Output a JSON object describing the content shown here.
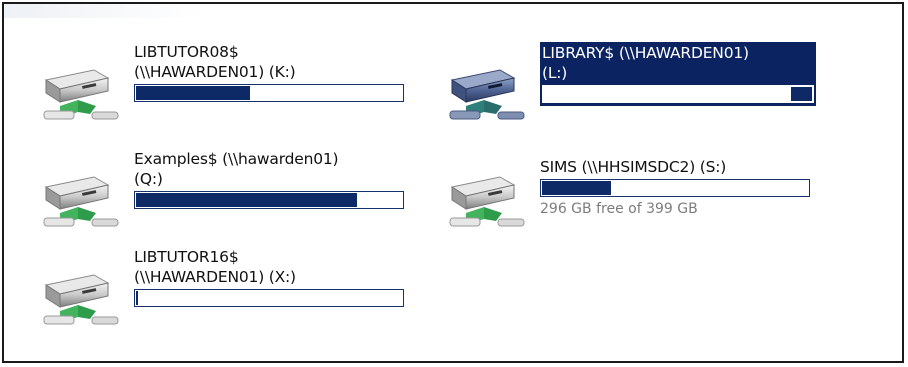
{
  "drives": [
    {
      "line1": "LIBTUTOR08$",
      "line2": "(\\\\HAWARDEN01) (K:)",
      "usage": 0.43,
      "selected": false,
      "icon": "network-drive-icon"
    },
    {
      "line1": "LIBRARY$ (\\\\HAWARDEN01)",
      "line2": "(L:)",
      "usage": 0.08,
      "selected": true,
      "icon": "network-drive-icon"
    },
    {
      "line1": "Examples$ (\\\\hawarden01)",
      "line2": "(Q:)",
      "usage": 0.83,
      "selected": false,
      "icon": "network-drive-icon"
    },
    {
      "line1": "SIMS (\\\\HHSIMSDC2) (S:)",
      "line2": "",
      "usage": 0.26,
      "free_text": "296 GB free of 399 GB",
      "selected": false,
      "icon": "network-drive-icon"
    },
    {
      "line1": "LIBTUTOR16$",
      "line2": "(\\\\HAWARDEN01) (X:)",
      "usage": 0.005,
      "selected": false,
      "icon": "network-drive-icon"
    }
  ],
  "colors": {
    "selection": "#0b2360",
    "bar_fill": "#0e2a66",
    "free_text": "#7d7d7d",
    "drive_green": "#39b05a"
  }
}
